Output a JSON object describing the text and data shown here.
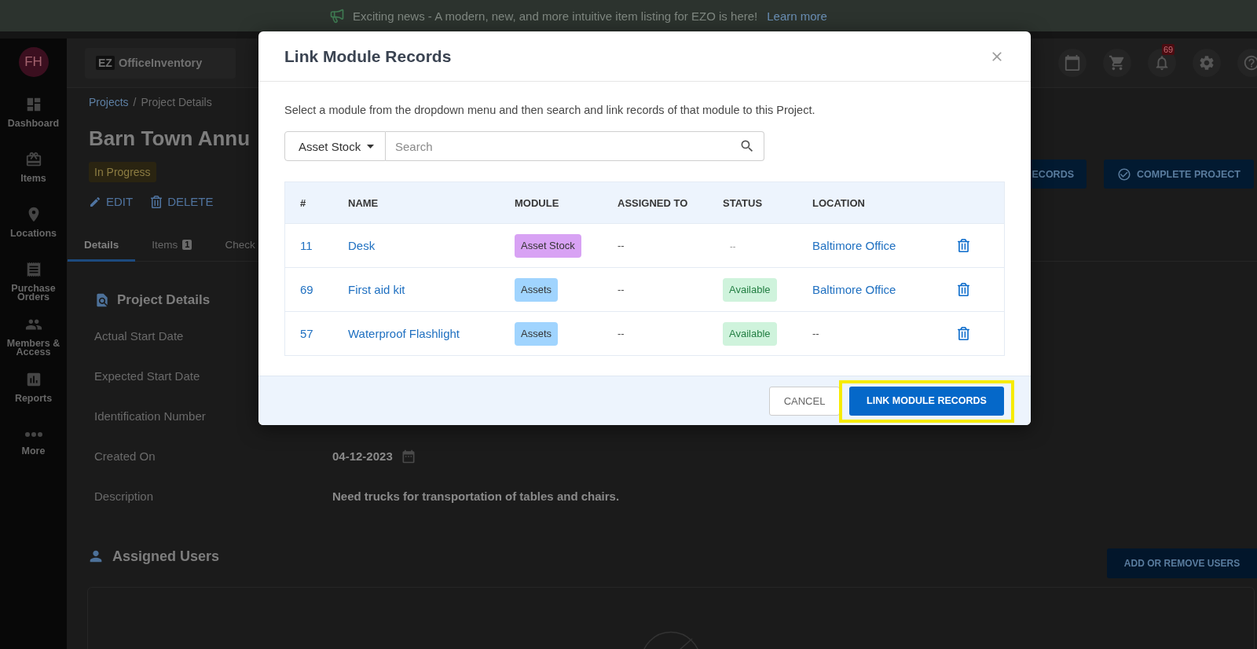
{
  "banner": {
    "text": "Exciting news - A modern, new, and more intuitive item listing for EZO is here!",
    "link": "Learn more"
  },
  "sidebar": {
    "avatar": "FH",
    "items": [
      {
        "label": "Dashboard"
      },
      {
        "label": "Items"
      },
      {
        "label": "Locations"
      },
      {
        "label": "Purchase Orders"
      },
      {
        "label": "Members & Access"
      },
      {
        "label": "Reports"
      },
      {
        "label": "More"
      }
    ]
  },
  "header": {
    "logo": {
      "badge": "EZ",
      "name": "OfficeInventory"
    },
    "notifications": "69"
  },
  "page": {
    "breadcrumb": {
      "items": [
        "Projects",
        "Project Details"
      ],
      "separator": "/"
    },
    "title": "Barn Town Annu",
    "status": "In Progress",
    "actions": [
      "EDIT",
      "DELETE"
    ],
    "buttons": [
      "ECORDS",
      "COMPLETE PROJECT"
    ],
    "tabs": [
      {
        "label": "Details",
        "selected": true
      },
      {
        "label": "Items",
        "count": "1",
        "selected": false
      },
      {
        "label": "Check",
        "selected": false
      }
    ],
    "project_details": {
      "title": "Project Details",
      "fields": [
        {
          "label": "Actual Start Date",
          "kind": "text"
        },
        {
          "label": "Expected Start Date",
          "kind": "text"
        },
        {
          "label": "Identification Number",
          "kind": "text"
        },
        {
          "label": "Created On",
          "value": "04-12-2023",
          "kind": "date"
        },
        {
          "label": "Description",
          "value": "Need trucks for transportation of tables and chairs.",
          "kind": "text"
        }
      ]
    },
    "assigned_users": {
      "title": "Assigned Users",
      "button": "ADD OR REMOVE USERS"
    }
  },
  "modal": {
    "title": "Link Module Records",
    "description": "Select a module from the dropdown menu and then search and link records of that module to this Project.",
    "module_select": {
      "value": "Asset Stock"
    },
    "search": {
      "placeholder": "Search"
    },
    "table": {
      "columns": [
        "#",
        "NAME",
        "MODULE",
        "ASSIGNED TO",
        "STATUS",
        "LOCATION"
      ],
      "rows": [
        {
          "number": "11",
          "name": "Desk",
          "module": {
            "label": "Asset Stock",
            "color": "#d8a2f4"
          },
          "assigned_to": "--",
          "status": {
            "kind": "none",
            "text": "--"
          },
          "location": {
            "kind": "link",
            "text": "Baltimore Office"
          }
        },
        {
          "number": "69",
          "name": "First aid kit",
          "module": {
            "label": "Assets",
            "color": "#a0d4fe"
          },
          "assigned_to": "--",
          "status": {
            "kind": "badge",
            "text": "Available"
          },
          "location": {
            "kind": "link",
            "text": "Baltimore Office"
          }
        },
        {
          "number": "57",
          "name": "Waterproof Flashlight",
          "module": {
            "label": "Assets",
            "color": "#a0d4fe"
          },
          "assigned_to": "--",
          "status": {
            "kind": "badge",
            "text": "Available"
          },
          "location": {
            "kind": "none",
            "text": "--"
          }
        }
      ]
    },
    "buttons": [
      {
        "label": "CANCEL",
        "kind": "secondary",
        "highlighted": false
      },
      {
        "label": "LINK MODULE RECORDS",
        "kind": "primary",
        "highlighted": true
      }
    ]
  }
}
